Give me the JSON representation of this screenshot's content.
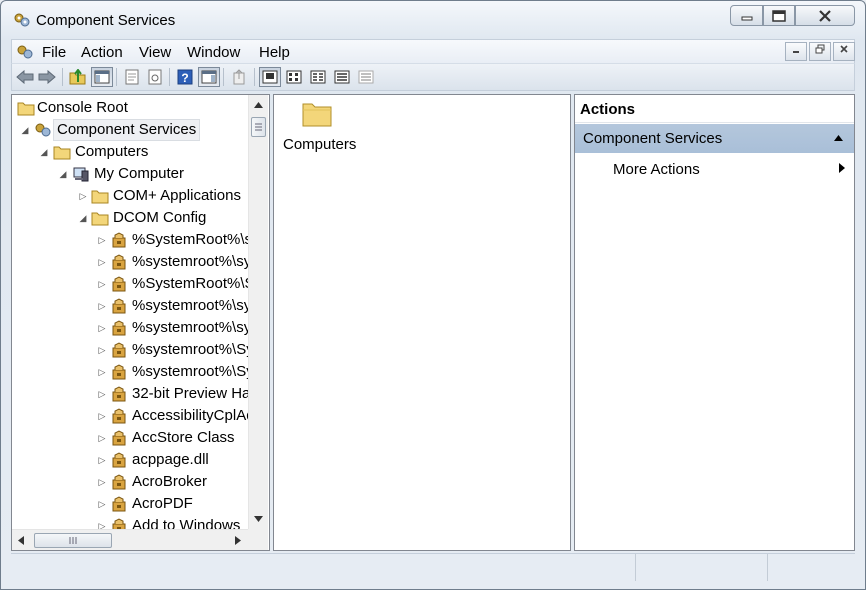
{
  "window": {
    "title": "Component Services"
  },
  "menu": [
    "File",
    "Action",
    "View",
    "Window",
    "Help"
  ],
  "toolbar": {
    "buttons": [
      "back-icon",
      "forward-icon",
      "up-folder-icon",
      "show-hide-console-tree-icon",
      "properties-icon",
      "refresh-icon",
      "help-icon",
      "show-hide-action-pane-icon",
      "export-list-icon",
      "large-icons-view-icon",
      "small-icons-view-icon",
      "list-view-icon",
      "detail-view-icon",
      "properties-view-icon"
    ]
  },
  "tree": {
    "root": "Console Root",
    "component_services": "Component Services",
    "computers": "Computers",
    "my_computer": "My Computer",
    "com_plus": "COM+ Applications",
    "dcom_config": "DCOM Config",
    "dcom_items": [
      "%SystemRoot%\\s",
      "%systemroot%\\sy",
      "%SystemRoot%\\S",
      "%systemroot%\\sy",
      "%systemroot%\\sy",
      "%systemroot%\\Sy",
      "%systemroot%\\Sy",
      "32-bit Preview Ha",
      "AccessibilityCplAd",
      "AccStore Class",
      "acppage.dll",
      "AcroBroker",
      "AcroPDF",
      "Add to Windows"
    ]
  },
  "list": {
    "items": [
      "Computers"
    ]
  },
  "actions": {
    "title": "Actions",
    "section": "Component Services",
    "more": "More Actions"
  },
  "colors": {
    "action_header": "#b4c7dc",
    "folder": "#f3d67a"
  }
}
